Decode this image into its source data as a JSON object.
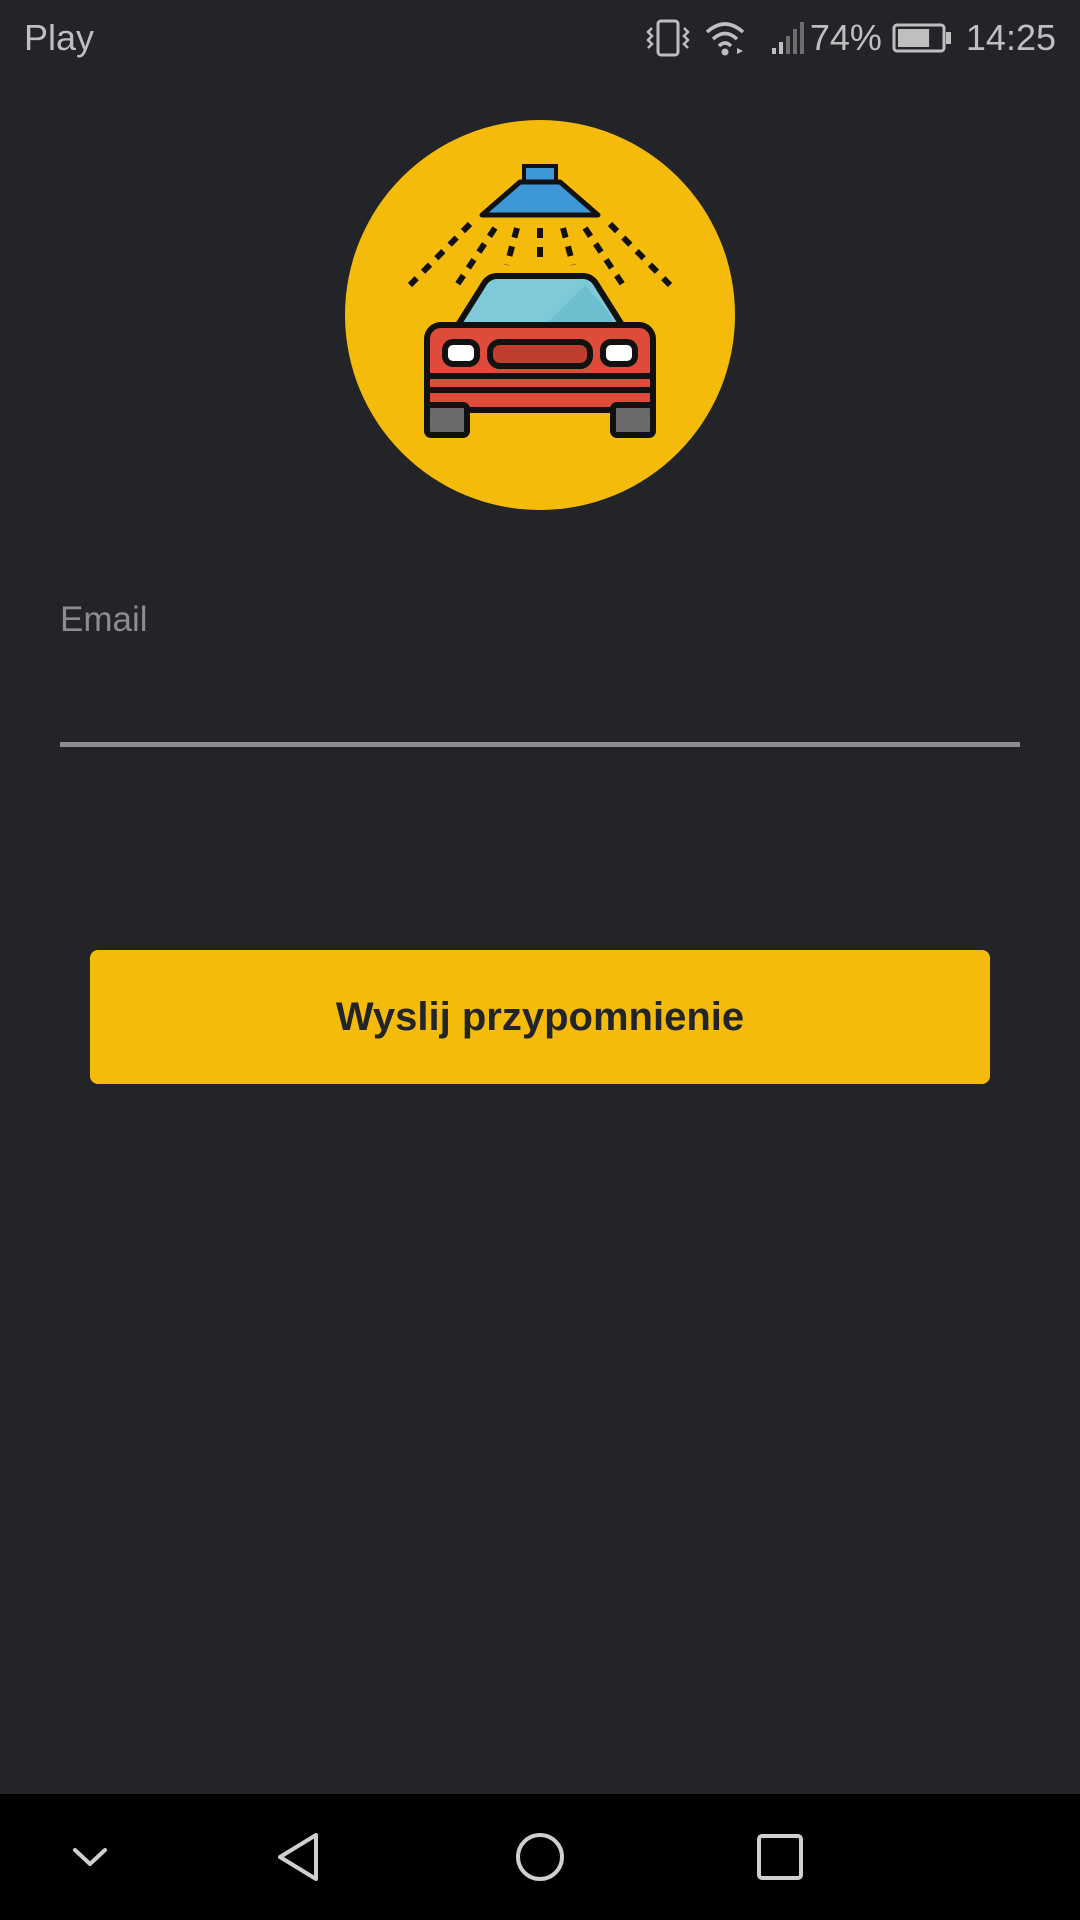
{
  "status_bar": {
    "carrier": "Play",
    "battery_percent": "74%",
    "time": "14:25",
    "icons": [
      "vibrate-icon",
      "wifi-icon",
      "signal-icon",
      "battery-icon"
    ],
    "battery_level": 0.74
  },
  "logo": {
    "icon": "car-wash-icon",
    "colors": {
      "circle": "#f5bb0b",
      "car_body": "#de4b3a",
      "windshield": "#7fcad8",
      "sprinkler": "#3e98d8"
    }
  },
  "form": {
    "email_label": "Email",
    "email_value": "",
    "submit_label": "Wyslij przypomnienie"
  },
  "nav_bar": {
    "icons": [
      "chevron-down-icon",
      "back-icon",
      "home-icon",
      "recents-icon"
    ]
  },
  "colors": {
    "background": "#222428",
    "accent": "#f5bb0b",
    "muted_text": "#8a8c8f"
  }
}
